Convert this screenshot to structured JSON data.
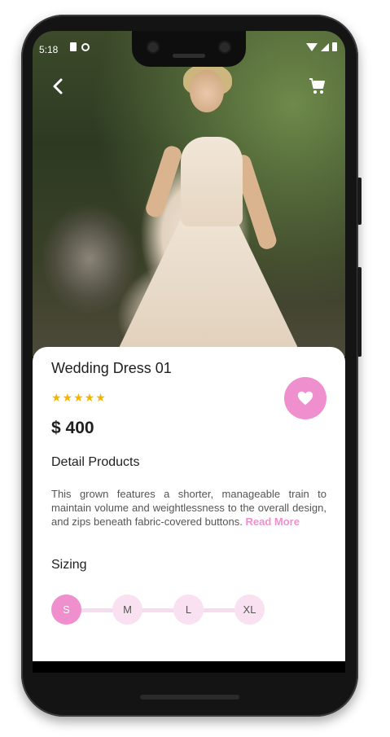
{
  "status_bar": {
    "time": "5:18"
  },
  "product": {
    "title": "Wedding Dress 01",
    "rating_stars": "★★★★★",
    "price": "$ 400",
    "detail_heading": "Detail Products",
    "description": "This grown features a shorter, manageable train to maintain volume and weightlessness to the overall design, and zips beneath fabric-covered buttons.",
    "read_more": "Read More",
    "sizing_heading": "Sizing",
    "sizes": [
      "S",
      "M",
      "L",
      "XL"
    ],
    "selected_size": "S"
  },
  "colors": {
    "accent": "#ef8fce",
    "star": "#f5b400"
  },
  "icons": {
    "back": "chevron-left-icon",
    "cart": "cart-icon",
    "favorite": "heart-icon"
  }
}
